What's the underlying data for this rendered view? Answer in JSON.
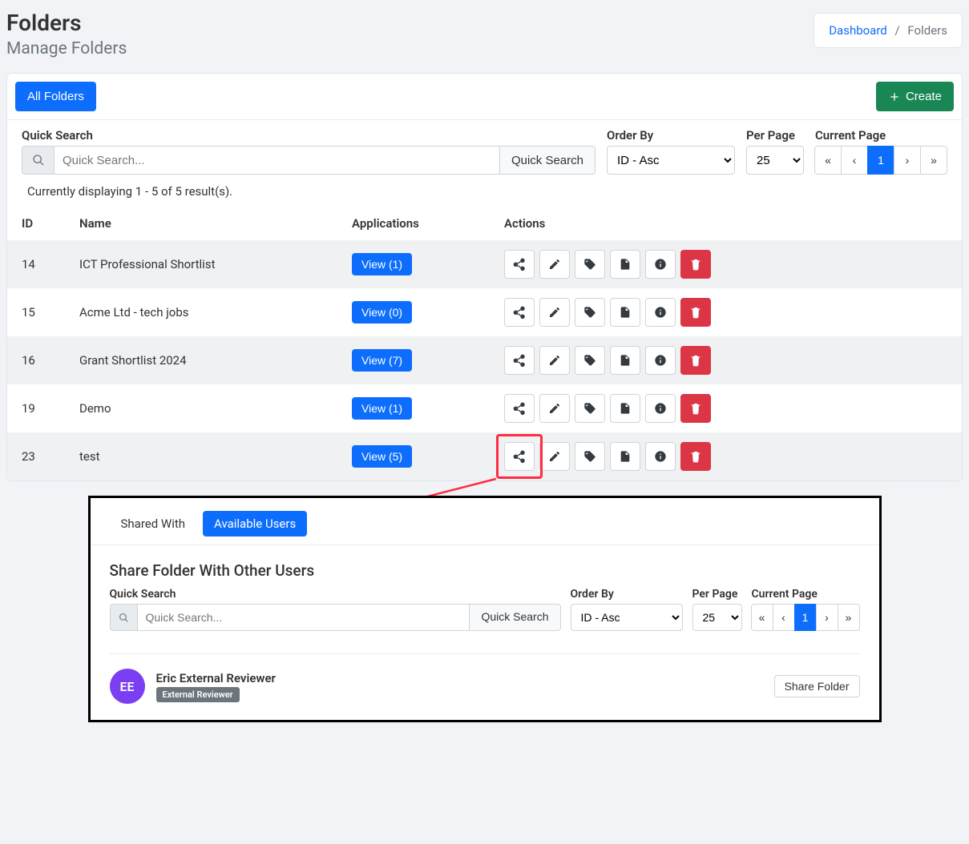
{
  "page": {
    "title": "Folders",
    "subtitle": "Manage Folders"
  },
  "breadcrumb": {
    "dashboard": "Dashboard",
    "sep": "/",
    "current": "Folders"
  },
  "toolbar": {
    "all_folders": "All Folders",
    "create": "Create"
  },
  "filters": {
    "quick_search_label": "Quick Search",
    "quick_search_placeholder": "Quick Search...",
    "quick_search_btn": "Quick Search",
    "order_by_label": "Order By",
    "order_by_value": "ID - Asc",
    "per_page_label": "Per Page",
    "per_page_value": "25",
    "current_page_label": "Current Page",
    "pager": {
      "first": "«",
      "prev": "‹",
      "page": "1",
      "next": "›",
      "last": "»"
    }
  },
  "results_text": "Currently displaying 1 - 5 of 5 result(s).",
  "columns": {
    "id": "ID",
    "name": "Name",
    "apps": "Applications",
    "actions": "Actions"
  },
  "rows": [
    {
      "id": "14",
      "name": "ICT Professional Shortlist",
      "view": "View (1)"
    },
    {
      "id": "15",
      "name": "Acme Ltd - tech jobs",
      "view": "View (0)"
    },
    {
      "id": "16",
      "name": "Grant Shortlist 2024",
      "view": "View (7)"
    },
    {
      "id": "19",
      "name": "Demo",
      "view": "View (1)"
    },
    {
      "id": "23",
      "name": "test",
      "view": "View (5)"
    }
  ],
  "modal": {
    "tab_shared_with": "Shared With",
    "tab_available_users": "Available Users",
    "heading": "Share Folder With Other Users",
    "filters": {
      "quick_search_label": "Quick Search",
      "quick_search_placeholder": "Quick Search...",
      "quick_search_btn": "Quick Search",
      "order_by_label": "Order By",
      "order_by_value": "ID - Asc",
      "per_page_label": "Per Page",
      "per_page_value": "25",
      "current_page_label": "Current Page",
      "pager": {
        "first": "«",
        "prev": "‹",
        "page": "1",
        "next": "›",
        "last": "»"
      }
    },
    "user": {
      "initials": "EE",
      "name": "Eric External Reviewer",
      "role": "External Reviewer",
      "share_btn": "Share Folder"
    }
  }
}
